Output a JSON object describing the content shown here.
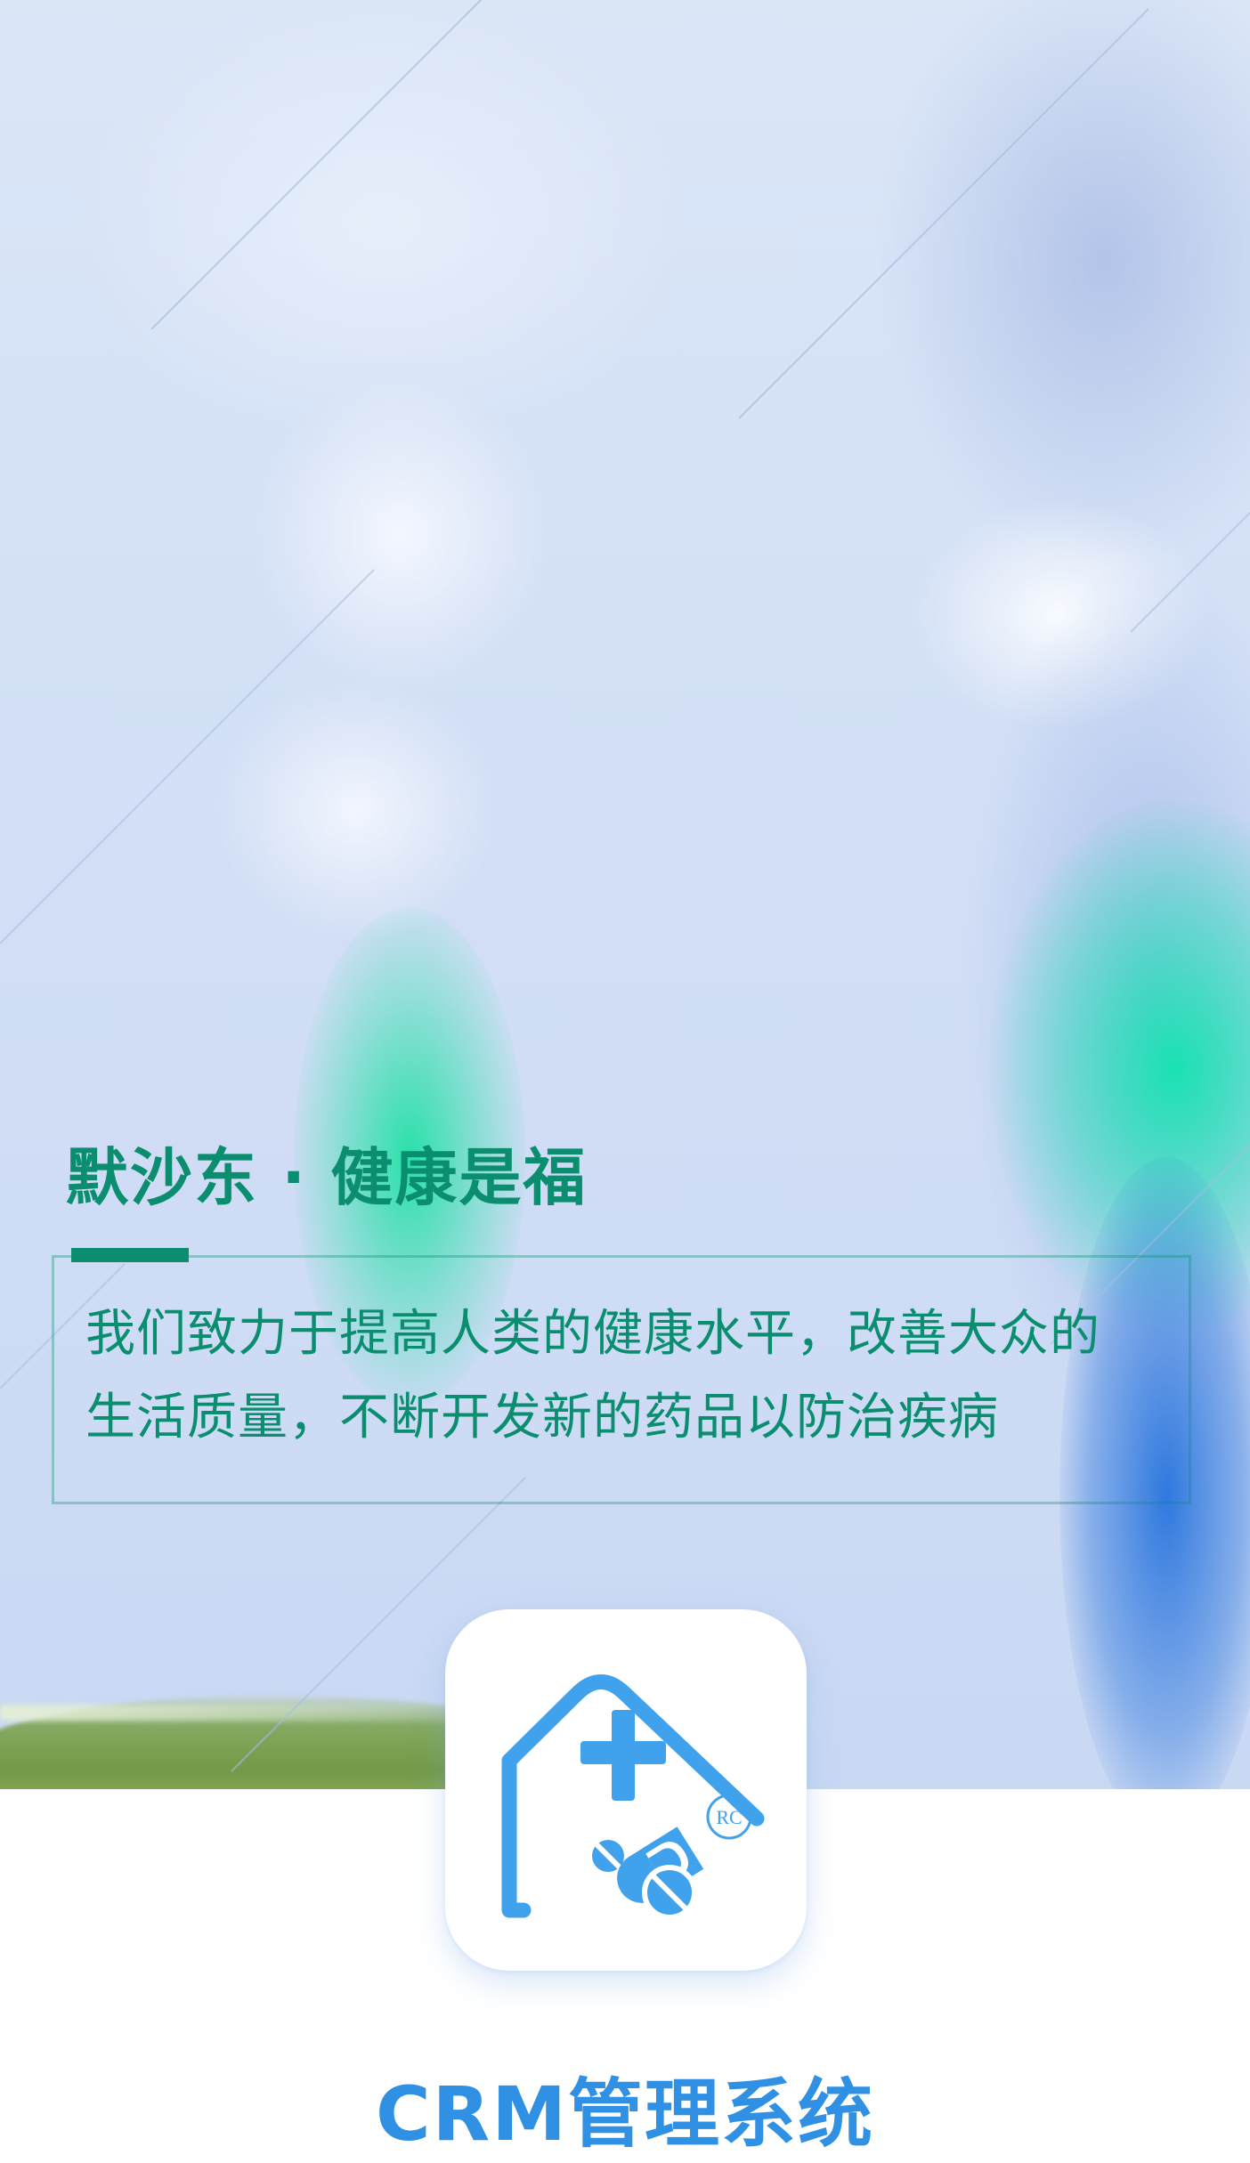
{
  "hero": {
    "title": "默沙东 · 健康是福",
    "mission_lines": [
      "我们致力于提高人类的健康水平，改善大众的",
      "生活质量，不断开发新的药品以防治疾病"
    ]
  },
  "app": {
    "icon_name": "medical-home-icon",
    "icon_badge": "RC",
    "name": "CRM管理系统"
  },
  "colors": {
    "brand_green": "#0b8e70",
    "brand_blue": "#2f90e4",
    "icon_blue": "#40a2ec"
  }
}
